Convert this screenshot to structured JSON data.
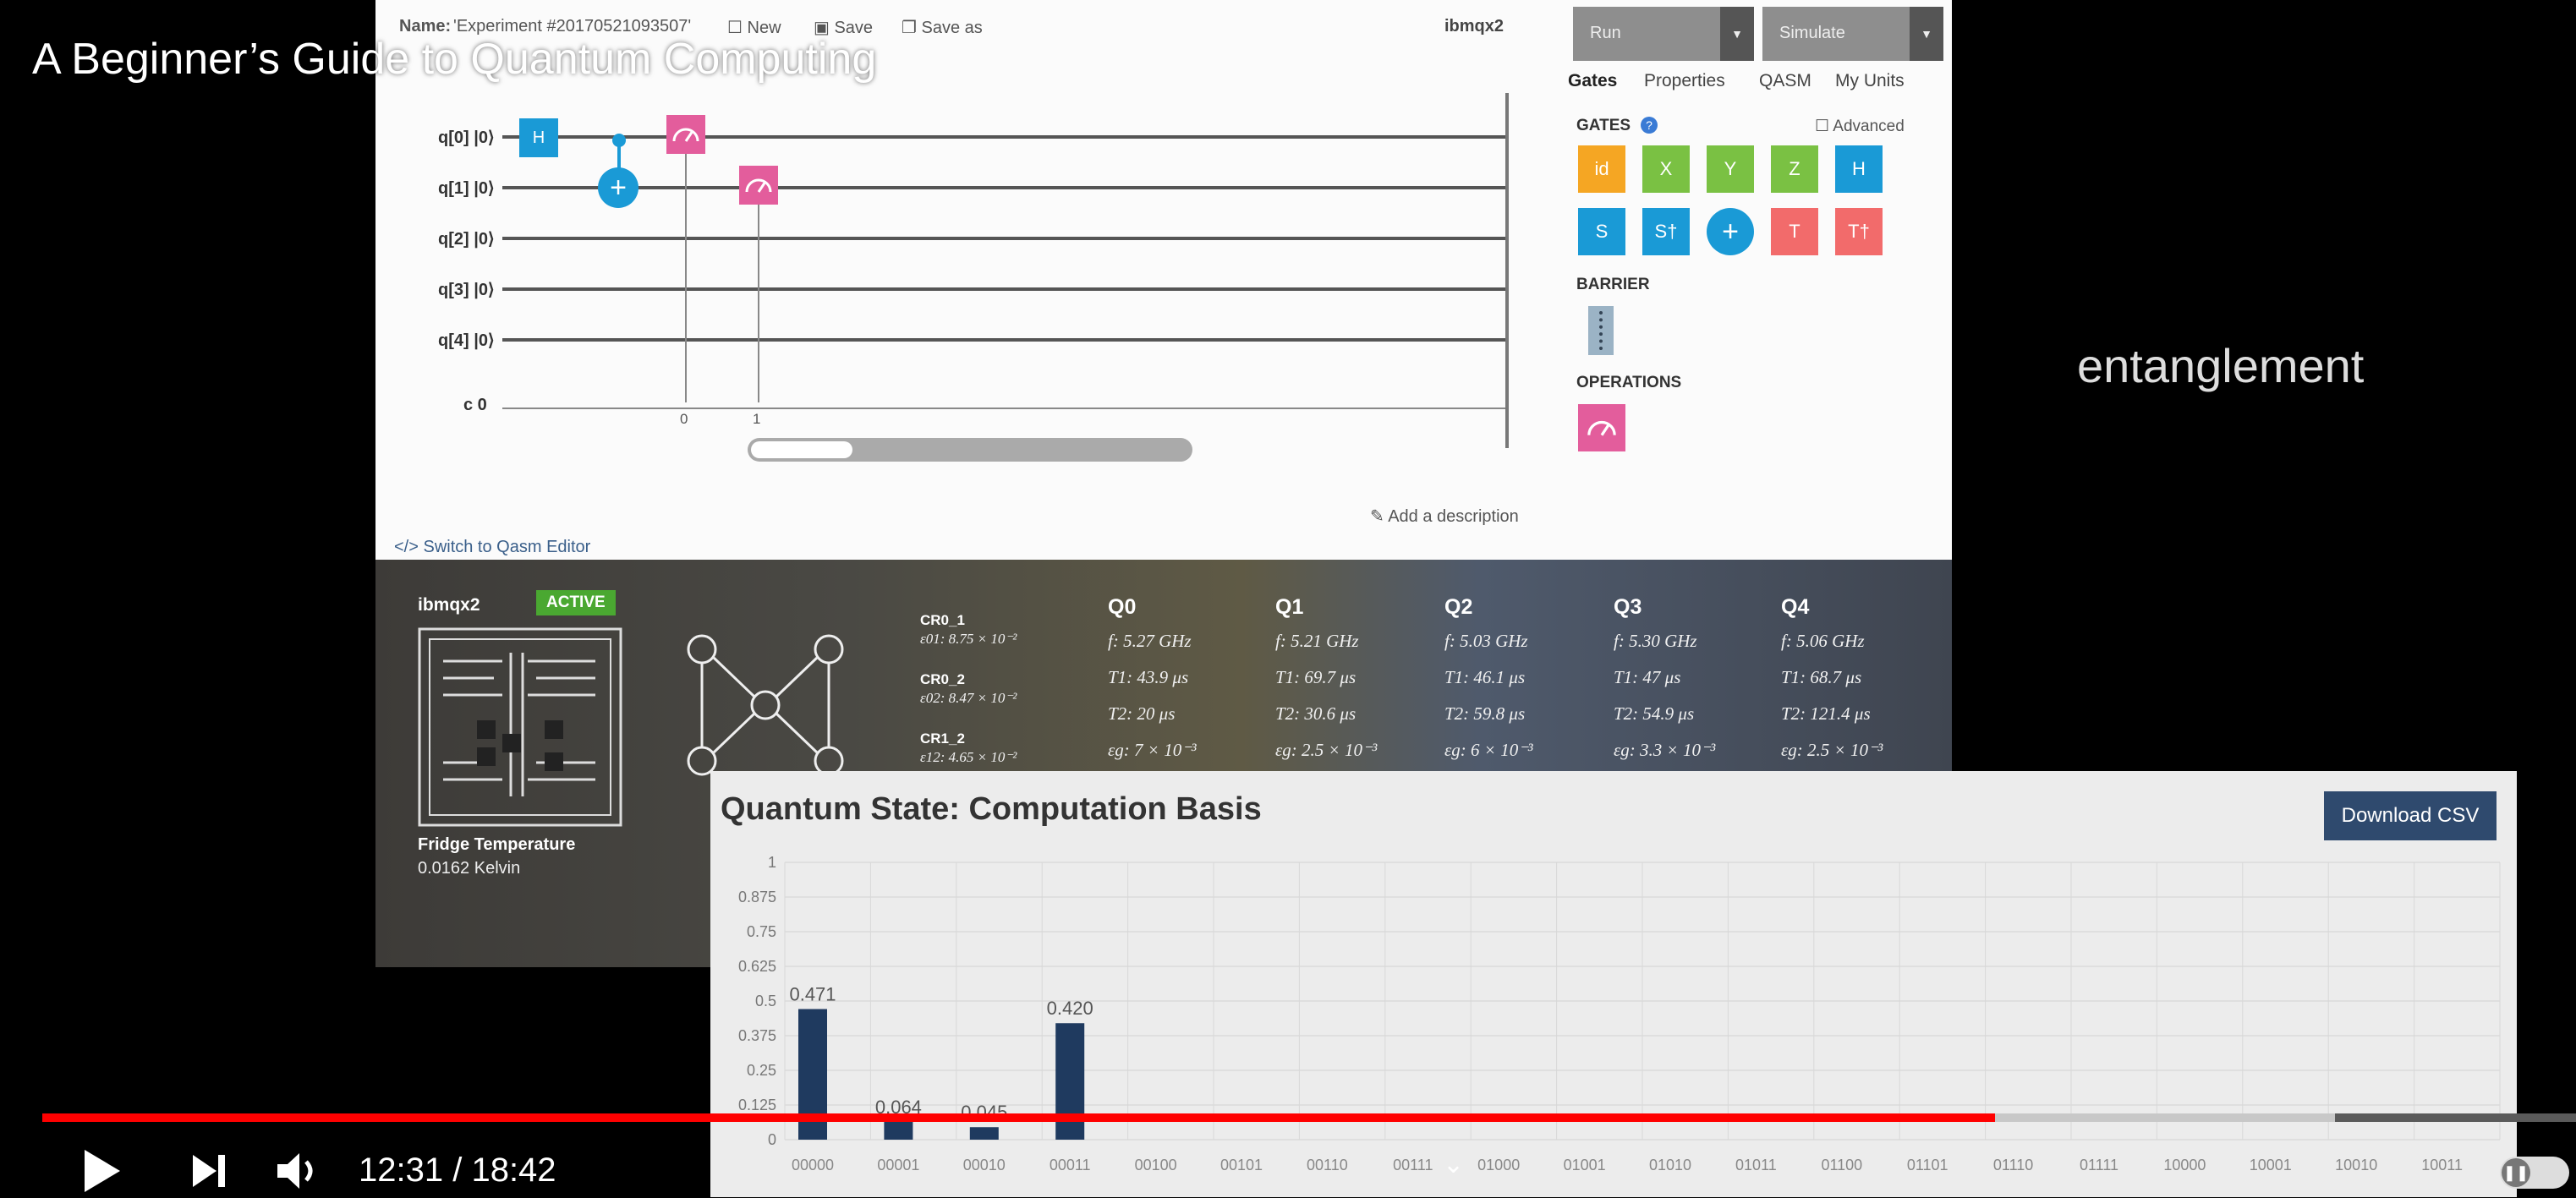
{
  "video": {
    "title": "A Beginner’s Guide to Quantum Computing",
    "caption": "entanglement",
    "time_current": "12:31",
    "time_separator": " / ",
    "time_total": "18:42",
    "progress_played": 0.7707,
    "progress_buffered": 0.905
  },
  "composer": {
    "name_label": "Name:",
    "name_value": "'Experiment #20170521093507'",
    "new_label": "New",
    "save_label": "Save",
    "saveas_label": "Save as",
    "device": "ibmqx2",
    "run_label": "Run",
    "simulate_label": "Simulate",
    "tabs": [
      "Gates",
      "Properties",
      "QASM",
      "My Units"
    ],
    "qubits": [
      "q[0] |0⟩",
      "q[1] |0⟩",
      "q[2] |0⟩",
      "q[3] |0⟩",
      "q[4] |0⟩"
    ],
    "classical_label": "c  0",
    "classical_bits": [
      "0",
      "1"
    ],
    "gate_h": "H",
    "gates_heading": "GATES",
    "advanced_label": "Advanced",
    "palette_gates": [
      "id",
      "X",
      "Y",
      "Z",
      "H",
      "S",
      "S†",
      "+",
      "T",
      "T†"
    ],
    "barrier_heading": "BARRIER",
    "operations_heading": "OPERATIONS",
    "add_description": "Add a description",
    "switch_editor": "</> Switch to Qasm Editor"
  },
  "device_panel": {
    "name": "ibmqx2",
    "status": "ACTIVE",
    "fridge_label": "Fridge Temperature",
    "fridge_value": "0.0162 Kelvin",
    "couplings": [
      {
        "name": "CR0_1",
        "value": "ε01: 8.75 × 10⁻²"
      },
      {
        "name": "CR0_2",
        "value": "ε02: 8.47 × 10⁻²"
      },
      {
        "name": "CR1_2",
        "value": "ε12: 4.65 × 10⁻²"
      }
    ],
    "qubits": [
      {
        "name": "Q0",
        "f": "f: 5.27 GHz",
        "t1": "T1: 43.9 μs",
        "t2": "T2: 20 μs",
        "eg": "εg: 7 × 10⁻³"
      },
      {
        "name": "Q1",
        "f": "f: 5.21 GHz",
        "t1": "T1: 69.7 μs",
        "t2": "T2: 30.6 μs",
        "eg": "εg: 2.5 × 10⁻³"
      },
      {
        "name": "Q2",
        "f": "f: 5.03 GHz",
        "t1": "T1: 46.1 μs",
        "t2": "T2: 59.8 μs",
        "eg": "εg: 6 × 10⁻³"
      },
      {
        "name": "Q3",
        "f": "f: 5.30 GHz",
        "t1": "T1: 47 μs",
        "t2": "T2: 54.9 μs",
        "eg": "εg: 3.3 × 10⁻³"
      },
      {
        "name": "Q4",
        "f": "f: 5.06 GHz",
        "t1": "T1: 68.7 μs",
        "t2": "T2: 121.4 μs",
        "eg": "εg: 2.5 × 10⁻³"
      }
    ]
  },
  "chart_panel": {
    "title": "Quantum State: Computation Basis",
    "download_label": "Download CSV"
  },
  "chart_data": {
    "type": "bar",
    "title": "Quantum State: Computation Basis",
    "categories": [
      "00000",
      "00001",
      "00010",
      "00011",
      "00100",
      "00101",
      "00110",
      "00111",
      "01000",
      "01001",
      "01010",
      "01011",
      "01100",
      "01101",
      "01110",
      "01111",
      "10000",
      "10001",
      "10010",
      "10011"
    ],
    "values": [
      0.471,
      0.064,
      0.045,
      0.42,
      0,
      0,
      0,
      0,
      0,
      0,
      0,
      0,
      0,
      0,
      0,
      0,
      0,
      0,
      0,
      0
    ],
    "labels": [
      "0.471",
      "0.064",
      "0.045",
      "0.420"
    ],
    "yticks": [
      "0",
      "0.125",
      "0.25",
      "0.375",
      "0.5",
      "0.625",
      "0.75",
      "0.875",
      "1"
    ],
    "ylim": [
      0,
      1
    ],
    "bar_color": "#1f3a5f",
    "grid": true
  },
  "colors": {
    "progress_played": "#ff0000",
    "active_badge": "#4aa831",
    "gate_blue": "#1a9ad6",
    "gate_pink": "#e35d9c",
    "gate_orange": "#f5a623",
    "gate_green": "#7ac143",
    "gate_red": "#f26b6b",
    "download_button": "#2f4a6e"
  }
}
